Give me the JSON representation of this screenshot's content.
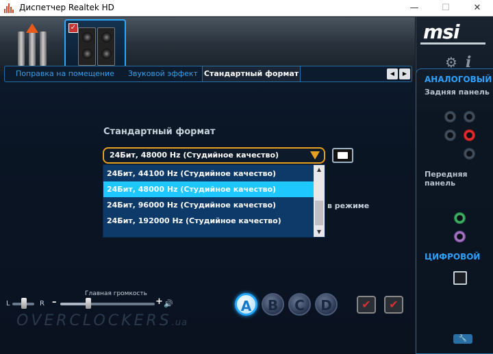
{
  "window": {
    "title": "Диспетчер Realtek HD",
    "min_label": "—",
    "max_label": "☐",
    "close_label": "✕"
  },
  "tabs": {
    "items": [
      {
        "label": "Поправка на помещение"
      },
      {
        "label": "Звуковой эффект"
      },
      {
        "label": "Стандартный формат"
      }
    ],
    "left_arrow": "◀",
    "right_arrow": "▶"
  },
  "format": {
    "section_title": "Стандартный формат",
    "selected_value": "24Бит, 48000 Hz (Студийное качество)",
    "options": [
      "24Бит, 44100 Hz (Студийное качество)",
      "24Бит, 48000 Hz (Студийное качество)",
      "24Бит, 96000 Hz (Студийное качество)",
      "24Бит, 192000 Hz (Студийное качество)"
    ],
    "selected_index": 1,
    "partial_text": "в режиме"
  },
  "volume": {
    "label": "Главная громкость",
    "left": "L",
    "right": "R",
    "minus": "–",
    "plus": "+",
    "level_percent": 30,
    "balance_percent": 50,
    "speaker_glyph": "🔊"
  },
  "profiles": {
    "a": "A",
    "b": "B",
    "c": "C",
    "d": "D",
    "active": "A"
  },
  "watermark": {
    "text": "OVERCLOCKERS",
    "suffix": ".ua"
  },
  "right_panel": {
    "logo": "msi",
    "analog_title": "АНАЛОГОВЫЙ",
    "rear_title": "Задняя панель",
    "front_title": "Передняя панель",
    "digital_title": "ЦИФРОВОЙ",
    "gear_glyph": "⚙",
    "info_glyph": "i",
    "wrench_glyph": "🔧"
  },
  "colors": {
    "accent_blue": "#2ea0ff",
    "select_border": "#e8a020",
    "dropdown_selected": "#1ec8ff",
    "jack_red": "#ff3030",
    "jack_green": "#4ac870",
    "jack_purple": "#b888d8"
  }
}
